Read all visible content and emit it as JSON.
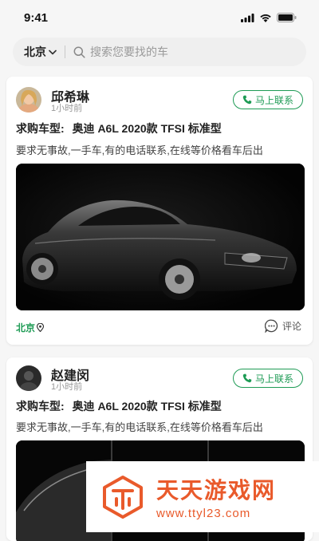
{
  "status_bar": {
    "time": "9:41"
  },
  "search": {
    "city": "北京",
    "placeholder": "搜索您要找的车"
  },
  "posts": [
    {
      "name": "邱希琳",
      "time": "1小时前",
      "contact_label": "马上联系",
      "model_label": "求购车型:",
      "model": "奥迪 A6L 2020款 TFSI 标准型",
      "description": "要求无事故,一手车,有的电话联系,在线等价格看车后出",
      "location": "北京",
      "comment_label": "评论"
    },
    {
      "name": "赵建闵",
      "time": "1小时前",
      "contact_label": "马上联系",
      "model_label": "求购车型:",
      "model": "奥迪 A6L 2020款 TFSI 标准型",
      "description": "要求无事故,一手车,有的电话联系,在线等价格看车后出"
    }
  ],
  "watermark": {
    "title": "天天游戏网",
    "url": "www.ttyl23.com"
  },
  "colors": {
    "accent_green": "#1e9b55",
    "watermark_orange": "#e95a2b"
  }
}
